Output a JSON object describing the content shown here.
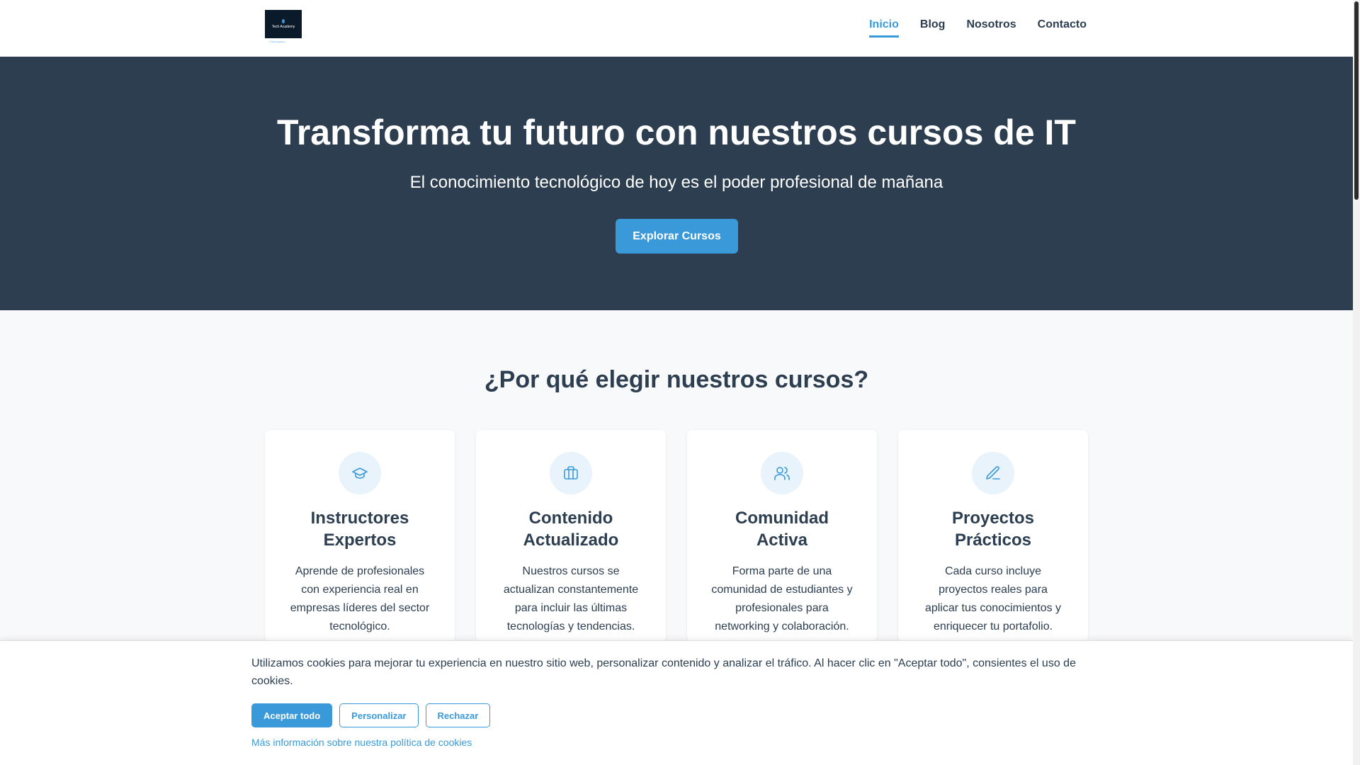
{
  "header": {
    "logo_text": "Tech Academy",
    "logo_subtext": "© Tech Academy",
    "nav": [
      {
        "label": "Inicio",
        "active": true
      },
      {
        "label": "Blog"
      },
      {
        "label": "Nosotros"
      },
      {
        "label": "Contacto"
      }
    ]
  },
  "hero": {
    "title": "Transforma tu futuro con nuestros cursos de IT",
    "subtitle": "El conocimiento tecnológico de hoy es el poder profesional de mañana",
    "cta_label": "Explorar Cursos"
  },
  "features": {
    "title": "¿Por qué elegir nuestros cursos?",
    "cards": [
      {
        "icon": "graduation-cap-icon",
        "title_line1": "Instructores",
        "title_line2": "Expertos",
        "text": "Aprende de profesionales con experiencia real en empresas líderes del sector tecnológico."
      },
      {
        "icon": "briefcase-icon",
        "title_line1": "Contenido",
        "title_line2": "Actualizado",
        "text": "Nuestros cursos se actualizan constantemente para incluir las últimas tecnologías y tendencias."
      },
      {
        "icon": "users-icon",
        "title_line1": "Comunidad",
        "title_line2": "Activa",
        "text": "Forma parte de una comunidad de estudiantes y profesionales para networking y colaboración."
      },
      {
        "icon": "pencil-icon",
        "title_line1": "Proyectos",
        "title_line2": "Prácticos",
        "text": "Cada curso incluye proyectos reales para aplicar tus conocimientos y enriquecer tu portafolio."
      }
    ]
  },
  "cookie_banner": {
    "message": "Utilizamos cookies para mejorar tu experiencia en nuestro sitio web, personalizar contenido y analizar el tráfico. Al hacer clic en \"Aceptar todo\", consientes el uso de cookies.",
    "accept_label": "Aceptar todo",
    "customize_label": "Personalizar",
    "reject_label": "Rechazar",
    "more_info_label": "Más información sobre nuestra política de cookies"
  },
  "colors": {
    "primary": "#3a9ad9",
    "dark": "#2c3e50",
    "background": "#f8f9fa"
  }
}
